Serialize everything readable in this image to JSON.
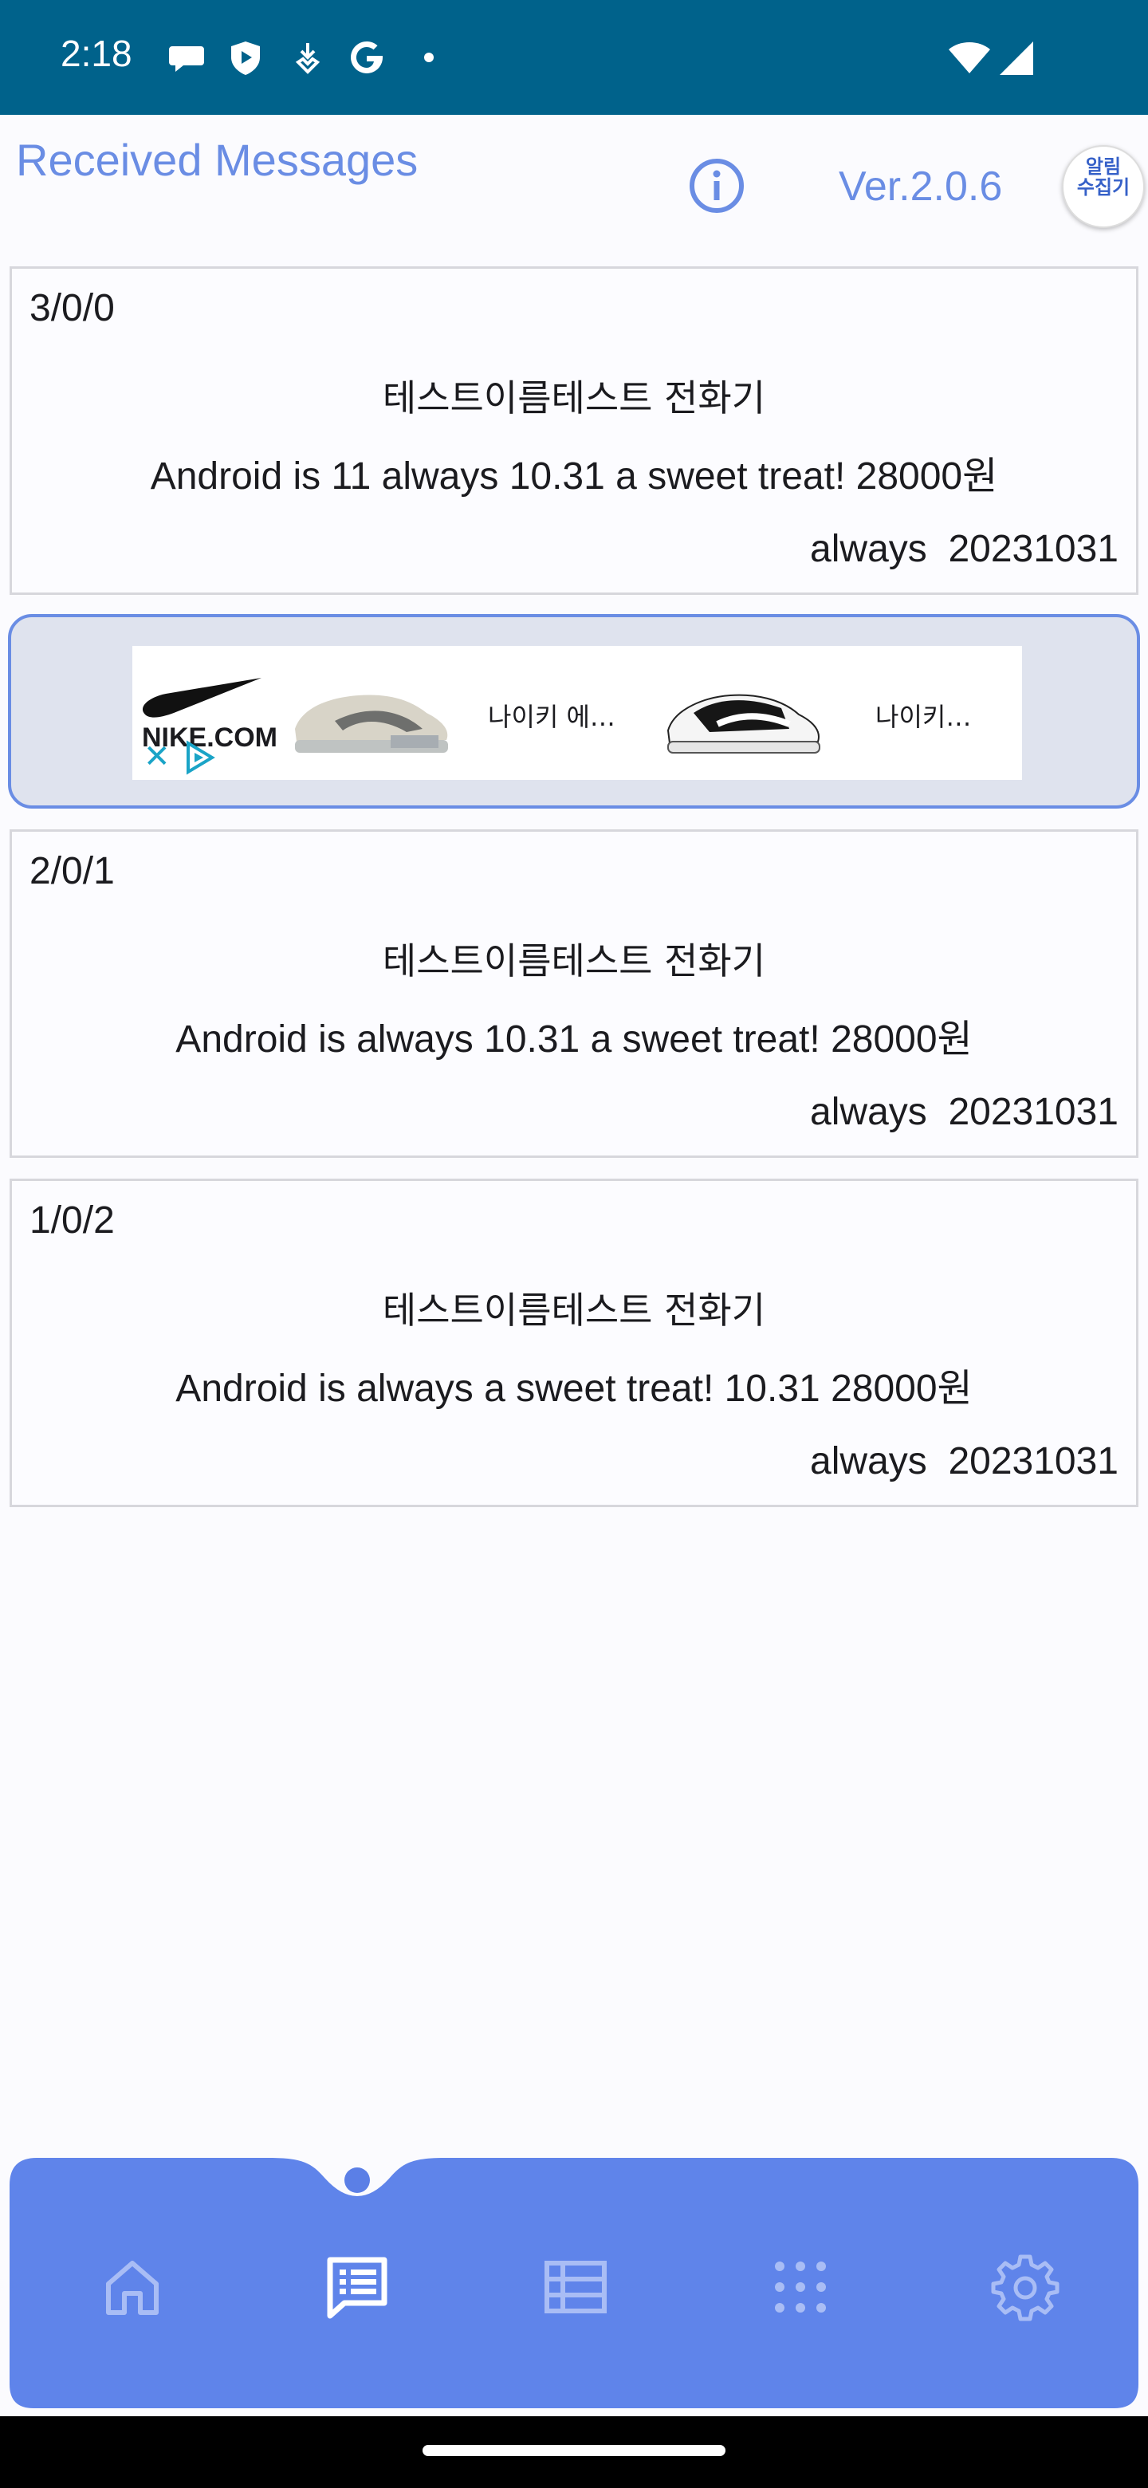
{
  "status_bar": {
    "time": "2:18"
  },
  "header": {
    "title": "Received Messages",
    "version": "Ver.2.0.6",
    "logo_text": "알림\n수집기"
  },
  "messages": [
    {
      "id": "3/0/0",
      "name": "테스트이름테스트 전화기",
      "body": "Android is 11 always 10.31  a sweet treat!  28000원",
      "meta": "always  20231031"
    },
    {
      "id": "2/0/1",
      "name": "테스트이름테스트 전화기",
      "body": "Android is always 10.31  a sweet treat!  28000원",
      "meta": "always  20231031"
    },
    {
      "id": "1/0/2",
      "name": "테스트이름테스트 전화기",
      "body": "Android is always a sweet treat! 10.31 28000원",
      "meta": "always  20231031"
    }
  ],
  "ad": {
    "brand": "NIKE.COM",
    "item1_label": "나이키 에…",
    "item2_label": "나이키…"
  },
  "bottom_nav": {
    "active": "messages",
    "items": [
      "home",
      "messages",
      "table",
      "apps",
      "settings"
    ]
  },
  "colors": {
    "status_bar": "#00628b",
    "accent": "#6a8de4",
    "nav_bg": "#5f84ea"
  }
}
